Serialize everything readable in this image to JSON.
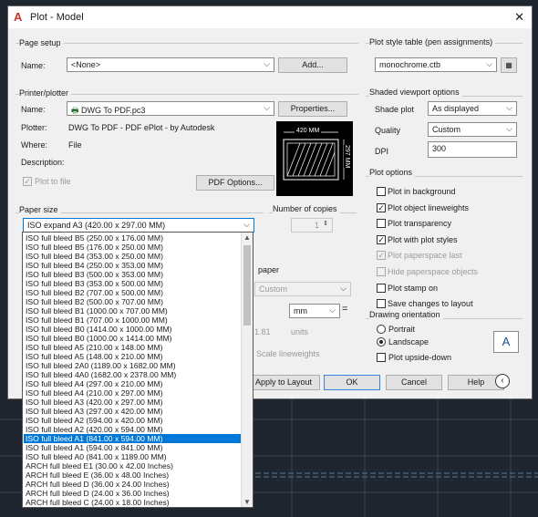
{
  "window": {
    "title": "Plot - Model",
    "close_glyph": "✕",
    "logo_glyph": "A"
  },
  "page_setup": {
    "group": "Page setup",
    "name_label": "Name:",
    "name_value": "<None>",
    "add_button": "Add..."
  },
  "printer": {
    "group": "Printer/plotter",
    "name_label": "Name:",
    "name_value": "DWG To PDF.pc3",
    "properties_button": "Properties...",
    "plotter_label": "Plotter:",
    "plotter_value": "DWG To PDF - PDF ePlot - by Autodesk",
    "where_label": "Where:",
    "where_value": "File",
    "description_label": "Description:",
    "plot_to_file": "Plot to file",
    "pdf_options_button": "PDF Options...",
    "preview_width": "420 MM",
    "preview_height": "297 MM"
  },
  "paper_size": {
    "group": "Paper size",
    "selected": "ISO expand A3 (420.00 x 297.00 MM)"
  },
  "copies": {
    "group": "Number of copies",
    "value": "1"
  },
  "paper_list": [
    "ISO full bleed B5 (250.00 x 176.00 MM)",
    "ISO full bleed B5 (176.00 x 250.00 MM)",
    "ISO full bleed B4 (353.00 x 250.00 MM)",
    "ISO full bleed B4 (250.00 x 353.00 MM)",
    "ISO full bleed B3 (500.00 x 353.00 MM)",
    "ISO full bleed B3 (353.00 x 500.00 MM)",
    "ISO full bleed B2 (707.00 x 500.00 MM)",
    "ISO full bleed B2 (500.00 x 707.00 MM)",
    "ISO full bleed B1 (1000.00 x 707.00 MM)",
    "ISO full bleed B1 (707.00 x 1000.00 MM)",
    "ISO full bleed B0 (1414.00 x 1000.00 MM)",
    "ISO full bleed B0 (1000.00 x 1414.00 MM)",
    "ISO full bleed A5 (210.00 x 148.00 MM)",
    "ISO full bleed A5 (148.00 x 210.00 MM)",
    "ISO full bleed 2A0 (1189.00 x 1682.00 MM)",
    "ISO full bleed 4A0 (1682.00 x 2378.00 MM)",
    "ISO full bleed A4 (297.00 x 210.00 MM)",
    "ISO full bleed A4 (210.00 x 297.00 MM)",
    "ISO full bleed A3 (420.00 x 297.00 MM)",
    "ISO full bleed A3 (297.00 x 420.00 MM)",
    "ISO full bleed A2 (594.00 x 420.00 MM)",
    "ISO full bleed A2 (420.00 x 594.00 MM)",
    "ISO full bleed A1 (841.00 x 594.00 MM)",
    "ISO full bleed A1 (594.00 x 841.00 MM)",
    "ISO full bleed A0 (841.00 x 1189.00 MM)",
    "ARCH full bleed E1 (30.00 x 42.00 Inches)",
    "ARCH full bleed E (36.00 x 48.00 Inches)",
    "ARCH full bleed D (36.00 x 24.00 Inches)",
    "ARCH full bleed D (24.00 x 36.00 Inches)",
    "ARCH full bleed C (24.00 x 18.00 Inches)"
  ],
  "paper_list_selected_index": 22,
  "hidden_behind": {
    "paper_label": "paper",
    "custom": "Custom",
    "mm": "mm",
    "units_value": "1.81",
    "units_label": "units",
    "scale_lw": "Scale lineweights",
    "equals": "="
  },
  "plot_style": {
    "group": "Plot style table (pen assignments)",
    "value": "monochrome.ctb"
  },
  "shaded": {
    "group": "Shaded viewport options",
    "shade_label": "Shade plot",
    "shade_value": "As displayed",
    "quality_label": "Quality",
    "quality_value": "Custom",
    "dpi_label": "DPI",
    "dpi_value": "300"
  },
  "plot_options": {
    "group": "Plot options",
    "items": [
      {
        "label": "Plot in background",
        "checked": false,
        "disabled": false
      },
      {
        "label": "Plot object lineweights",
        "checked": true,
        "disabled": false
      },
      {
        "label": "Plot transparency",
        "checked": false,
        "disabled": false
      },
      {
        "label": "Plot with plot styles",
        "checked": true,
        "disabled": false
      },
      {
        "label": "Plot paperspace last",
        "checked": true,
        "disabled": true
      },
      {
        "label": "Hide paperspace objects",
        "checked": false,
        "disabled": true
      },
      {
        "label": "Plot stamp on",
        "checked": false,
        "disabled": false
      },
      {
        "label": "Save changes to layout",
        "checked": false,
        "disabled": false
      }
    ]
  },
  "orientation": {
    "group": "Drawing orientation",
    "portrait": "Portrait",
    "landscape": "Landscape",
    "upside_down": "Plot upside-down",
    "selected": "landscape",
    "icon_letter": "A"
  },
  "buttons": {
    "apply": "Apply to Layout",
    "ok": "OK",
    "cancel": "Cancel",
    "help": "Help"
  },
  "icons": {
    "combo_arrow": "chevron-down-icon",
    "check": "checkmark-icon",
    "collapse": "chevron-left-circle-icon",
    "edit_style": "edit-table-icon"
  },
  "colors": {
    "selection": "#0078d7",
    "dialog": "#f0f0f0",
    "background": "#1f2630"
  }
}
